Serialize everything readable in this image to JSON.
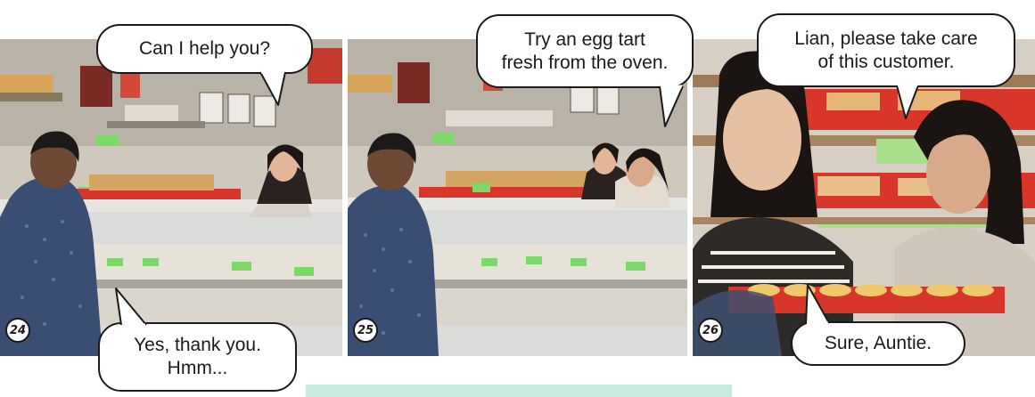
{
  "panels": [
    {
      "number": "24",
      "bubbles": [
        {
          "text": "Can I help you?"
        },
        {
          "text": "Yes, thank you.\nHmm..."
        }
      ]
    },
    {
      "number": "25",
      "bubbles": [
        {
          "text": "Try an egg tart\nfresh from the oven."
        }
      ]
    },
    {
      "number": "26",
      "bubbles": [
        {
          "text": "Lian, please take care\nof this customer."
        },
        {
          "text": "Sure, Auntie."
        }
      ]
    }
  ],
  "colors": {
    "accent_bar": "#c6ecdf",
    "bubble_border": "#1a1a1a",
    "label_green": "#7dd86a",
    "tray_red": "#d8362a"
  }
}
